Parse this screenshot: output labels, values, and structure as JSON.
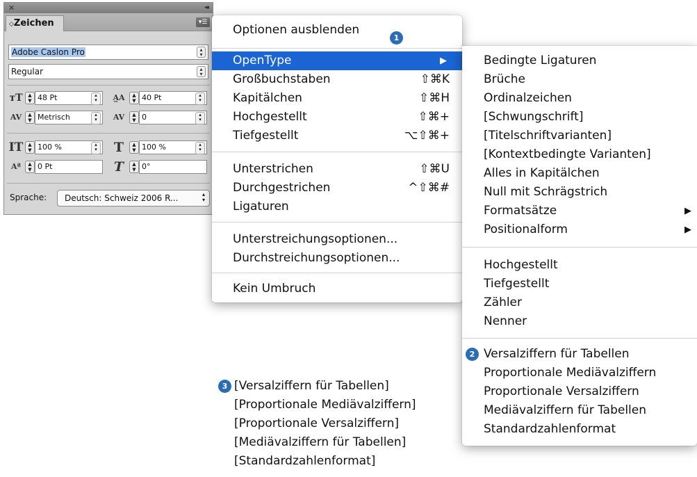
{
  "panel": {
    "title": "Zeichen",
    "font_family": "Adobe Caslon Pro",
    "font_style": "Regular",
    "font_size": "48 Pt",
    "leading": "40 Pt",
    "kerning": "Metrisch",
    "tracking": "0",
    "vertical_scale": "100 %",
    "horizontal_scale": "100 %",
    "baseline_shift": "0 Pt",
    "skew": "0°",
    "language_label": "Sprache:",
    "language_value": "Deutsch: Schweiz 2006 R..."
  },
  "main_menu": {
    "items": [
      {
        "label": "Optionen ausblenden",
        "shortcut": ""
      },
      {
        "label": "OpenType",
        "shortcut": "▶"
      },
      {
        "label": "Großbuchstaben",
        "shortcut": "⇧⌘K"
      },
      {
        "label": "Kapitälchen",
        "shortcut": "⇧⌘H"
      },
      {
        "label": "Hochgestellt",
        "shortcut": "⇧⌘+"
      },
      {
        "label": "Tiefgestellt",
        "shortcut": "⌥⇧⌘+"
      },
      {
        "label": "Unterstrichen",
        "shortcut": "⇧⌘U"
      },
      {
        "label": "Durchgestrichen",
        "shortcut": "^⇧⌘#"
      },
      {
        "label": "Ligaturen",
        "shortcut": ""
      },
      {
        "label": "Unterstreichungsoptionen...",
        "shortcut": ""
      },
      {
        "label": "Durchstreichungsoptionen...",
        "shortcut": ""
      },
      {
        "label": "Kein Umbruch",
        "shortcut": ""
      }
    ]
  },
  "sub_menu": {
    "items": [
      "Bedingte Ligaturen",
      "Brüche",
      "Ordinalzeichen",
      "[Schwungschrift]",
      "[Titelschriftvarianten]",
      "[Kontextbedingte Varianten]",
      "Alles in Kapitälchen",
      "Null mit Schrägstrich",
      "Formatsätze",
      "Positionalform",
      "Hochgestellt",
      "Tiefgestellt",
      "Zähler",
      "Nenner",
      "Versalziffern für Tabellen",
      "Proportionale Mediävalziffern",
      "Proportionale Versalziffern",
      "Mediävalziffern für Tabellen",
      "Standardzahlenformat"
    ]
  },
  "note_lines": [
    "[Versalziffern für Tabellen]",
    "[Proportionale Mediävalziffern]",
    "[Proportionale Versalziffern]",
    "[Mediävalziffern für Tabellen]",
    "[Standardzahlenformat]"
  ],
  "badges": [
    "1",
    "2",
    "3"
  ],
  "colors": {
    "highlight": "#1a64d4",
    "badge": "#2b6cb6"
  }
}
